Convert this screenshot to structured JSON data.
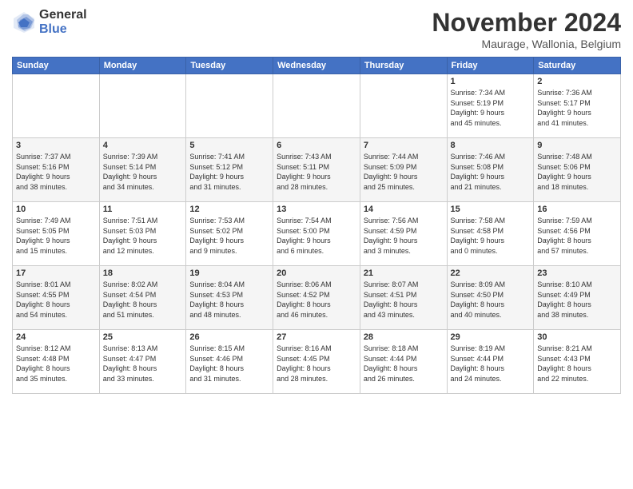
{
  "logo": {
    "general": "General",
    "blue": "Blue"
  },
  "title": "November 2024",
  "location": "Maurage, Wallonia, Belgium",
  "days_header": [
    "Sunday",
    "Monday",
    "Tuesday",
    "Wednesday",
    "Thursday",
    "Friday",
    "Saturday"
  ],
  "weeks": [
    [
      {
        "day": "",
        "info": ""
      },
      {
        "day": "",
        "info": ""
      },
      {
        "day": "",
        "info": ""
      },
      {
        "day": "",
        "info": ""
      },
      {
        "day": "",
        "info": ""
      },
      {
        "day": "1",
        "info": "Sunrise: 7:34 AM\nSunset: 5:19 PM\nDaylight: 9 hours\nand 45 minutes."
      },
      {
        "day": "2",
        "info": "Sunrise: 7:36 AM\nSunset: 5:17 PM\nDaylight: 9 hours\nand 41 minutes."
      }
    ],
    [
      {
        "day": "3",
        "info": "Sunrise: 7:37 AM\nSunset: 5:16 PM\nDaylight: 9 hours\nand 38 minutes."
      },
      {
        "day": "4",
        "info": "Sunrise: 7:39 AM\nSunset: 5:14 PM\nDaylight: 9 hours\nand 34 minutes."
      },
      {
        "day": "5",
        "info": "Sunrise: 7:41 AM\nSunset: 5:12 PM\nDaylight: 9 hours\nand 31 minutes."
      },
      {
        "day": "6",
        "info": "Sunrise: 7:43 AM\nSunset: 5:11 PM\nDaylight: 9 hours\nand 28 minutes."
      },
      {
        "day": "7",
        "info": "Sunrise: 7:44 AM\nSunset: 5:09 PM\nDaylight: 9 hours\nand 25 minutes."
      },
      {
        "day": "8",
        "info": "Sunrise: 7:46 AM\nSunset: 5:08 PM\nDaylight: 9 hours\nand 21 minutes."
      },
      {
        "day": "9",
        "info": "Sunrise: 7:48 AM\nSunset: 5:06 PM\nDaylight: 9 hours\nand 18 minutes."
      }
    ],
    [
      {
        "day": "10",
        "info": "Sunrise: 7:49 AM\nSunset: 5:05 PM\nDaylight: 9 hours\nand 15 minutes."
      },
      {
        "day": "11",
        "info": "Sunrise: 7:51 AM\nSunset: 5:03 PM\nDaylight: 9 hours\nand 12 minutes."
      },
      {
        "day": "12",
        "info": "Sunrise: 7:53 AM\nSunset: 5:02 PM\nDaylight: 9 hours\nand 9 minutes."
      },
      {
        "day": "13",
        "info": "Sunrise: 7:54 AM\nSunset: 5:00 PM\nDaylight: 9 hours\nand 6 minutes."
      },
      {
        "day": "14",
        "info": "Sunrise: 7:56 AM\nSunset: 4:59 PM\nDaylight: 9 hours\nand 3 minutes."
      },
      {
        "day": "15",
        "info": "Sunrise: 7:58 AM\nSunset: 4:58 PM\nDaylight: 9 hours\nand 0 minutes."
      },
      {
        "day": "16",
        "info": "Sunrise: 7:59 AM\nSunset: 4:56 PM\nDaylight: 8 hours\nand 57 minutes."
      }
    ],
    [
      {
        "day": "17",
        "info": "Sunrise: 8:01 AM\nSunset: 4:55 PM\nDaylight: 8 hours\nand 54 minutes."
      },
      {
        "day": "18",
        "info": "Sunrise: 8:02 AM\nSunset: 4:54 PM\nDaylight: 8 hours\nand 51 minutes."
      },
      {
        "day": "19",
        "info": "Sunrise: 8:04 AM\nSunset: 4:53 PM\nDaylight: 8 hours\nand 48 minutes."
      },
      {
        "day": "20",
        "info": "Sunrise: 8:06 AM\nSunset: 4:52 PM\nDaylight: 8 hours\nand 46 minutes."
      },
      {
        "day": "21",
        "info": "Sunrise: 8:07 AM\nSunset: 4:51 PM\nDaylight: 8 hours\nand 43 minutes."
      },
      {
        "day": "22",
        "info": "Sunrise: 8:09 AM\nSunset: 4:50 PM\nDaylight: 8 hours\nand 40 minutes."
      },
      {
        "day": "23",
        "info": "Sunrise: 8:10 AM\nSunset: 4:49 PM\nDaylight: 8 hours\nand 38 minutes."
      }
    ],
    [
      {
        "day": "24",
        "info": "Sunrise: 8:12 AM\nSunset: 4:48 PM\nDaylight: 8 hours\nand 35 minutes."
      },
      {
        "day": "25",
        "info": "Sunrise: 8:13 AM\nSunset: 4:47 PM\nDaylight: 8 hours\nand 33 minutes."
      },
      {
        "day": "26",
        "info": "Sunrise: 8:15 AM\nSunset: 4:46 PM\nDaylight: 8 hours\nand 31 minutes."
      },
      {
        "day": "27",
        "info": "Sunrise: 8:16 AM\nSunset: 4:45 PM\nDaylight: 8 hours\nand 28 minutes."
      },
      {
        "day": "28",
        "info": "Sunrise: 8:18 AM\nSunset: 4:44 PM\nDaylight: 8 hours\nand 26 minutes."
      },
      {
        "day": "29",
        "info": "Sunrise: 8:19 AM\nSunset: 4:44 PM\nDaylight: 8 hours\nand 24 minutes."
      },
      {
        "day": "30",
        "info": "Sunrise: 8:21 AM\nSunset: 4:43 PM\nDaylight: 8 hours\nand 22 minutes."
      }
    ]
  ]
}
